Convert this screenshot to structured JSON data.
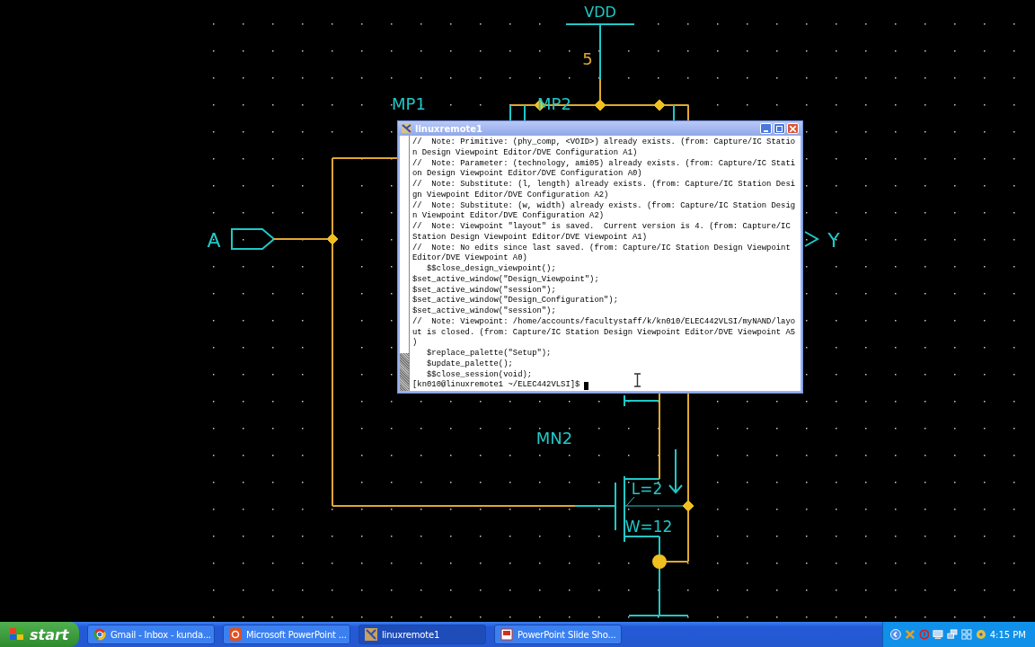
{
  "schematic": {
    "labels": [
      {
        "text": "VDD",
        "kind": "name"
      },
      {
        "text": "5",
        "kind": "value"
      },
      {
        "text": "MP1",
        "kind": "name"
      },
      {
        "text": "MP2",
        "kind": "name"
      },
      {
        "text": "A",
        "kind": "name"
      },
      {
        "text": "Y",
        "kind": "name"
      },
      {
        "text": "MN2",
        "kind": "name"
      },
      {
        "text": "L=2",
        "kind": "name"
      },
      {
        "text": "W=12",
        "kind": "name"
      }
    ]
  },
  "terminal": {
    "title": "linuxremote1",
    "lines": [
      "//  Note: Primitive: (phy_comp, <VOID>) already exists. (from: Capture/IC Statio",
      "n Design Viewpoint Editor/DVE Configuration A1)",
      "//  Note: Parameter: (technology, ami05) already exists. (from: Capture/IC Stati",
      "on Design Viewpoint Editor/DVE Configuration A0)",
      "//  Note: Substitute: (l, length) already exists. (from: Capture/IC Station Desi",
      "gn Viewpoint Editor/DVE Configuration A2)",
      "//  Note: Substitute: (w, width) already exists. (from: Capture/IC Station Desig",
      "n Viewpoint Editor/DVE Configuration A2)",
      "//  Note: Viewpoint \"layout\" is saved.  Current version is 4. (from: Capture/IC",
      "Station Design Viewpoint Editor/DVE Viewpoint A1)",
      "//  Note: No edits since last saved. (from: Capture/IC Station Design Viewpoint",
      "Editor/DVE Viewpoint A0)",
      "   $$close_design_viewpoint();",
      "$set_active_window(\"Design_Viewpoint\");",
      "$set_active_window(\"session\");",
      "$set_active_window(\"Design_Configuration\");",
      "$set_active_window(\"session\");",
      "//  Note: Viewpoint: /home/accounts/facultystaff/k/kn010/ELEC442VLSI/myNAND/layo",
      "ut is closed. (from: Capture/IC Station Design Viewpoint Editor/DVE Viewpoint A5",
      ")",
      "   $replace_palette(\"Setup\");",
      "   $update_palette();",
      "   $$close_session(void);"
    ],
    "prompt": "[kn010@linuxremote1 ~/ELEC442VLSI]$"
  },
  "taskbar": {
    "start": "start",
    "tasks": [
      {
        "label": "Gmail - Inbox - kunda...",
        "kind": "browser",
        "selected": false
      },
      {
        "label": "Microsoft PowerPoint ...",
        "kind": "powerpoint",
        "selected": false
      },
      {
        "label": "linuxremote1",
        "kind": "xterm",
        "selected": true
      },
      {
        "label": "PowerPoint Slide Sho...",
        "kind": "slideshow",
        "selected": false
      }
    ],
    "clock": "4:15 PM"
  }
}
